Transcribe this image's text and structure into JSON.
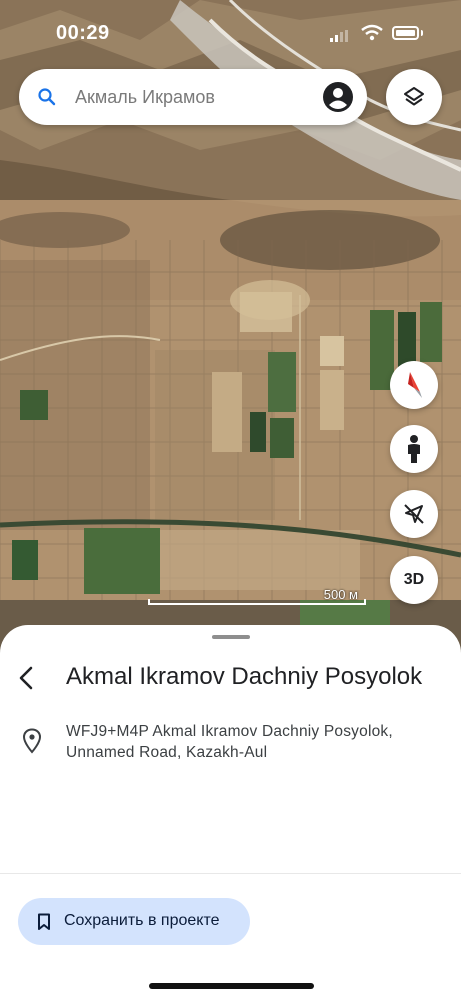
{
  "status_bar": {
    "time": "00:29"
  },
  "search": {
    "text": "Акмаль Икрамов"
  },
  "map": {
    "scale_label": "500 м",
    "three_d_label": "3D"
  },
  "place": {
    "title": "Akmal Ikramov Dachniy Posyolok",
    "address_line1": "WFJ9+M4P Akmal Ikramov Dachniy Posyolok,",
    "address_line2": "Unnamed Road, Kazakh-Aul"
  },
  "actions": {
    "save_label": "Сохранить в проекте"
  },
  "colors": {
    "accent": "#1a73e8",
    "save_button_bg": "#d3e3fd",
    "compass_red": "#ea4335"
  },
  "icons": [
    "search-icon",
    "account-icon",
    "layers-icon",
    "compass-icon",
    "pegman-icon",
    "location-off-icon",
    "back-icon",
    "pin-icon",
    "bookmark-icon"
  ]
}
